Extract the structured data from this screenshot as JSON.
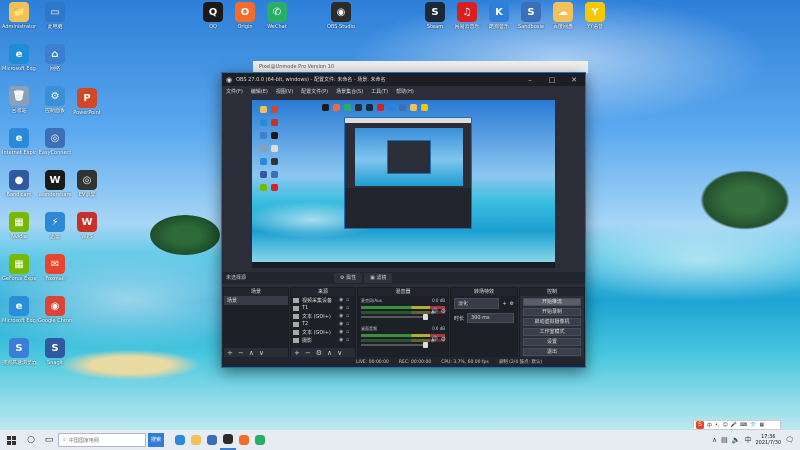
{
  "desktop": {
    "icons": [
      {
        "label": "Administrator",
        "color": "#f2c15a",
        "glyph": "📁"
      },
      {
        "label": "此电脑",
        "color": "#2f77c9",
        "glyph": "▭"
      },
      {
        "label": "Microsoft Edge",
        "color": "#1f8dd6",
        "glyph": "e"
      },
      {
        "label": "网络",
        "color": "#3a7fd0",
        "glyph": "⌂"
      },
      {
        "label": "回收站",
        "color": "#8aa0b8",
        "glyph": "🗑"
      },
      {
        "label": "控制面板",
        "color": "#3a90d8",
        "glyph": "⚙"
      },
      {
        "label": "Internet Explorer",
        "color": "#2b8ad8",
        "glyph": "e"
      },
      {
        "label": "EasyConnect",
        "color": "#3b6fb8",
        "glyph": "◎"
      },
      {
        "label": "Bandicam",
        "color": "#2f5aa0",
        "glyph": "●"
      },
      {
        "label": "Wondershare",
        "color": "#1a1a1a",
        "glyph": "W"
      },
      {
        "label": "Nvidia",
        "color": "#76b900",
        "glyph": "▦"
      },
      {
        "label": "GeForce Experience",
        "color": "#76b900",
        "glyph": "▦"
      },
      {
        "label": "迅雷",
        "color": "#2f87d8",
        "glyph": "⚡"
      },
      {
        "label": "Microsoft Edge",
        "color": "#2a8fd8",
        "glyph": "e"
      },
      {
        "label": "Google Chrome",
        "color": "#db4437",
        "glyph": "◉"
      },
      {
        "label": "搜狗高速浏览器",
        "color": "#3b7ed8",
        "glyph": "S"
      },
      {
        "label": "Foxmail",
        "color": "#e8442e",
        "glyph": "✉"
      },
      {
        "label": "Snagit",
        "color": "#2f5aa0",
        "glyph": "S"
      },
      {
        "label": "PowerPoint",
        "color": "#d24726",
        "glyph": "P"
      },
      {
        "label": "EV录屏",
        "color": "#333333",
        "glyph": "◎"
      },
      {
        "label": "WPS",
        "color": "#c8302a",
        "glyph": "W"
      },
      {
        "label": "QQ",
        "color": "#1a1a1a",
        "glyph": "Q"
      },
      {
        "label": "Origin",
        "color": "#f56c2d",
        "glyph": "O"
      },
      {
        "label": "WeChat",
        "color": "#2aae67",
        "glyph": "✆"
      },
      {
        "label": "OBS Studio",
        "color": "#2b2b2b",
        "glyph": "◉"
      },
      {
        "label": "Steam",
        "color": "#1b2838",
        "glyph": "S"
      },
      {
        "label": "网易云音乐",
        "color": "#d8201e",
        "glyph": "♫"
      },
      {
        "label": "酷狗音乐",
        "color": "#2f7fd8",
        "glyph": "K"
      },
      {
        "label": "Sandboxie",
        "color": "#3b6fb8",
        "glyph": "S"
      },
      {
        "label": "百度网盘",
        "color": "#f2c15a",
        "glyph": "☁"
      },
      {
        "label": "YY语音",
        "color": "#f5c800",
        "glyph": "Y"
      }
    ]
  },
  "obs": {
    "bg_window_title": "Pixel@Unmode Pro Version 10",
    "title": "OBS 27.0.0 (64-bit, windows) - 配置文件: 未命名 - 场景: 未命名",
    "menu": [
      "文件(F)",
      "编辑(E)",
      "视图(V)",
      "配置文件(P)",
      "场景集合(S)",
      "工具(T)",
      "帮助(H)"
    ],
    "filters_title": "未选择源",
    "tabs": [
      "⚙ 属性",
      "▣ 滤镜"
    ],
    "scenes": {
      "title": "场景",
      "items": [
        "场景"
      ]
    },
    "sources": {
      "title": "来源",
      "items": [
        "视频采集设备",
        "T1",
        "文本 (GDI+)",
        "T2",
        "文本 (GDI+)",
        "摄影"
      ]
    },
    "mixer": {
      "title": "混音器",
      "channels": [
        {
          "name": "麦克风/Aux",
          "db": "0.0 dB"
        },
        {
          "name": "桌面音频",
          "db": "0.0 dB"
        }
      ]
    },
    "transitions": {
      "title": "转场特效",
      "type": "淡化",
      "duration_label": "时长",
      "duration_value": "300 ms"
    },
    "controls": {
      "title": "控制",
      "buttons": [
        "开始推流",
        "开始录制",
        "启动虚拟摄像机",
        "工作室模式",
        "设置",
        "退出"
      ]
    },
    "status": {
      "live": "LIVE: 00:00:00",
      "rec": "REC: 00:00:00",
      "cpu": "CPU: 3.7%, 60.00 fps",
      "rec_info": "录制 (2/4 鼓点: 默认)"
    }
  },
  "taskbar": {
    "search_placeholder": "中国国家电网",
    "search_button": "搜索",
    "time": "17:36",
    "date": "2021/7/30",
    "ime_label": "中",
    "apps": [
      "#2b8ad8",
      "#f2c15a",
      "#3a6fb8",
      "#2b2b2b",
      "#f56c2d",
      "#2aae67"
    ]
  }
}
